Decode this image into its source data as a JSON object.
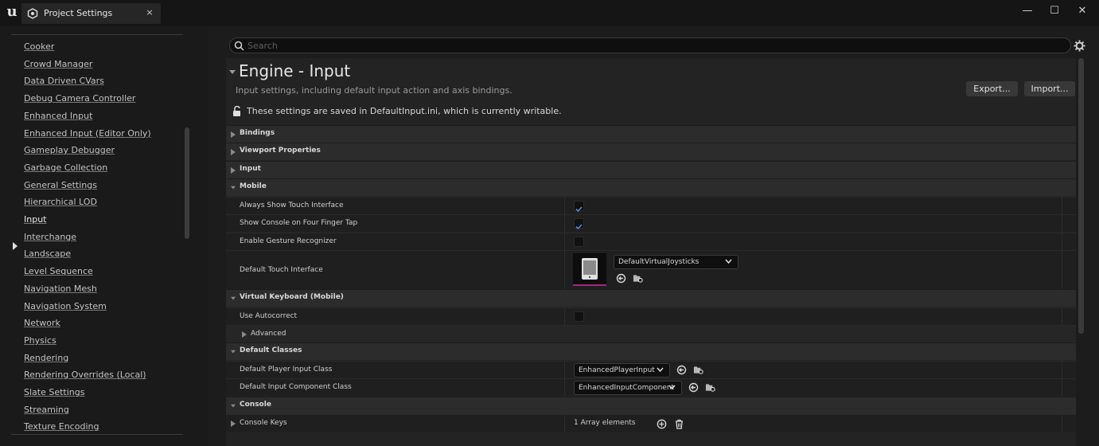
{
  "window": {
    "tab_title": "Project Settings",
    "tab_close": "×",
    "controls": {
      "minimize": "—",
      "maximize": "☐",
      "close": "✕"
    }
  },
  "sidebar": {
    "items": [
      {
        "label": "Cooker"
      },
      {
        "label": "Crowd Manager"
      },
      {
        "label": "Data Driven CVars"
      },
      {
        "label": "Debug Camera Controller"
      },
      {
        "label": "Enhanced Input"
      },
      {
        "label": "Enhanced Input (Editor Only)"
      },
      {
        "label": "Gameplay Debugger"
      },
      {
        "label": "Garbage Collection"
      },
      {
        "label": "General Settings"
      },
      {
        "label": "Hierarchical LOD"
      },
      {
        "label": "Input",
        "active": true
      },
      {
        "label": "Interchange"
      },
      {
        "label": "Landscape"
      },
      {
        "label": "Level Sequence"
      },
      {
        "label": "Navigation Mesh"
      },
      {
        "label": "Navigation System"
      },
      {
        "label": "Network"
      },
      {
        "label": "Physics"
      },
      {
        "label": "Rendering"
      },
      {
        "label": "Rendering Overrides (Local)"
      },
      {
        "label": "Slate Settings"
      },
      {
        "label": "Streaming"
      },
      {
        "label": "Texture Encoding"
      }
    ]
  },
  "search": {
    "placeholder": "Search",
    "value": ""
  },
  "page": {
    "title": "Engine - Input",
    "subtitle": "Input settings, including default input action and axis bindings.",
    "export_label": "Export...",
    "import_label": "Import...",
    "notice": "These settings are saved in DefaultInput.ini, which is currently writable."
  },
  "categories": {
    "bindings": "Bindings",
    "viewport": "Viewport Properties",
    "input": "Input",
    "mobile": "Mobile",
    "virtual_keyboard": "Virtual Keyboard (Mobile)",
    "advanced": "Advanced",
    "default_classes": "Default Classes",
    "console": "Console"
  },
  "properties": {
    "always_show_touch": {
      "label": "Always Show Touch Interface",
      "checked": true
    },
    "show_console_four_finger": {
      "label": "Show Console on Four Finger Tap",
      "checked": true
    },
    "enable_gesture": {
      "label": "Enable Gesture Recognizer",
      "checked": false
    },
    "default_touch_interface": {
      "label": "Default Touch Interface",
      "value": "DefaultVirtualJoysticks"
    },
    "use_autocorrect": {
      "label": "Use Autocorrect",
      "checked": false
    },
    "default_player_input_class": {
      "label": "Default Player Input Class",
      "value": "EnhancedPlayerInput"
    },
    "default_input_component_class": {
      "label": "Default Input Component Class",
      "value": "EnhancedInputComponent"
    },
    "console_keys": {
      "label": "Console Keys",
      "value": "1 Array elements"
    }
  },
  "colors": {
    "accent_check": "#4a8fe0",
    "thumbnail_underline": "#a3297c"
  }
}
